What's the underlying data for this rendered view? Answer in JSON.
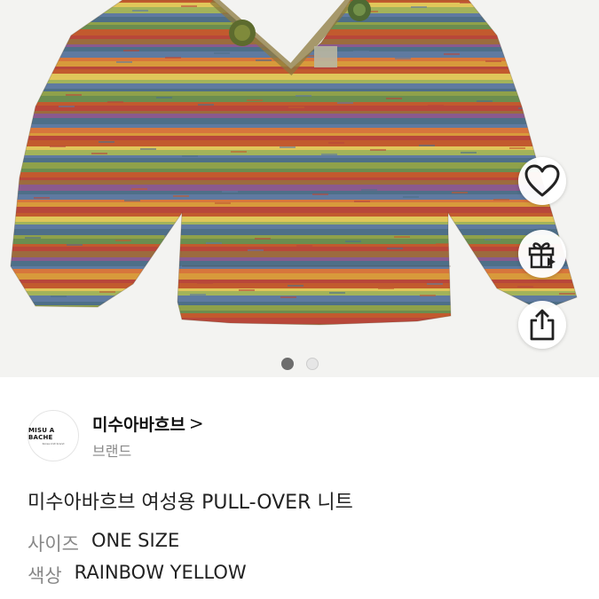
{
  "product": {
    "title": "미수아바흐브 여성용 PULL-OVER 니트",
    "image_alt": "rainbow striped knit pullover"
  },
  "gallery": {
    "page_count": 2,
    "active_index": 0
  },
  "actions": {
    "like_icon": "heart-icon",
    "gift_icon": "gift-icon",
    "share_icon": "share-icon"
  },
  "brand": {
    "name": "미수아바흐브",
    "chevron": ">",
    "type_label": "브랜드",
    "logo_text": "MISU A BACHE",
    "logo_subtext": "Korea knit brand"
  },
  "specs": {
    "size_label": "사이즈",
    "size_value": "ONE SIZE",
    "color_label": "색상",
    "color_value": "RAINBOW YELLOW"
  },
  "colors": {
    "stripes": [
      "#c25a2e",
      "#d89a3b",
      "#8fa14a",
      "#5f7aa0",
      "#8a5a8e",
      "#e0c65a",
      "#b8473a",
      "#6b8d4f",
      "#d7763c",
      "#4e6f88",
      "#a3b35a",
      "#9c6b3e"
    ]
  }
}
